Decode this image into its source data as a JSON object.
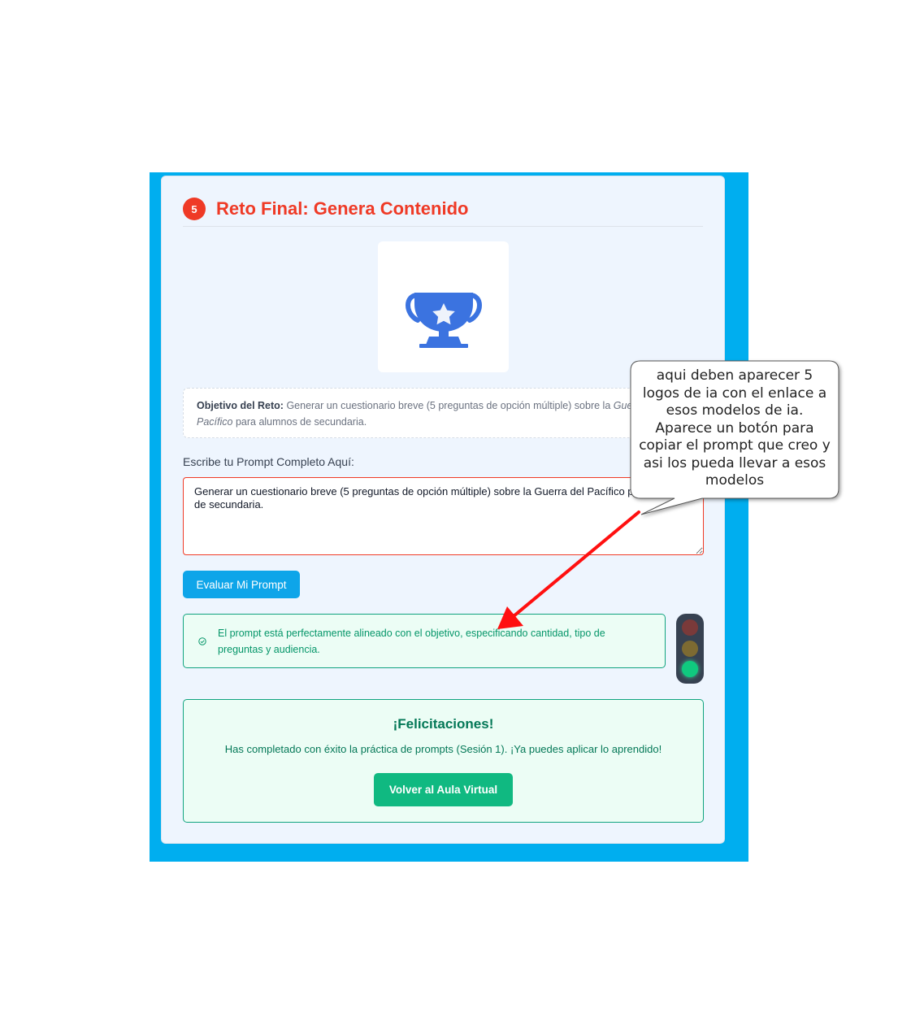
{
  "challenge": {
    "step_number": "5",
    "title": "Reto Final: Genera Contenido",
    "icon": "trophy-star-icon",
    "objective_label": "Objetivo del Reto:",
    "objective_text": "Generar un cuestionario breve (5 preguntas de opción múltiple) sobre la",
    "objective_italic": "Guerra del Pacífico",
    "objective_tail": "para alumnos de secundaria."
  },
  "prompt": {
    "label": "Escribe tu Prompt Completo Aquí:",
    "value": "Generar un cuestionario breve (5 preguntas de opción múltiple) sobre la Guerra del Pacífico para alumnos de secundaria."
  },
  "evaluate_button": "Evaluar Mi Prompt",
  "feedback": {
    "icon": "check-circle-icon",
    "text": "El prompt está perfectamente alineado con el objetivo, especificando cantidad, tipo de preguntas y audiencia.",
    "traffic_light_state": "green"
  },
  "congrats": {
    "title": "¡Felicitaciones!",
    "message": "Has completado con éxito la práctica de prompts (Sesión 1). ¡Ya puedes aplicar lo aprendido!",
    "button": "Volver al Aula Virtual"
  },
  "annotation": {
    "text": "aqui deben aparecer 5\nlogos de ia con el enlace a\nesos modelos de ia.\nAparece un botón para\ncopiar el prompt que creo y\nasi los pueda llevar a esos\nmodelos"
  },
  "colors": {
    "frame": "#00aeef",
    "accent_red": "#ef3a26",
    "success": "#10b981",
    "button_blue": "#0ea5e9",
    "trophy": "#3b73e0"
  }
}
